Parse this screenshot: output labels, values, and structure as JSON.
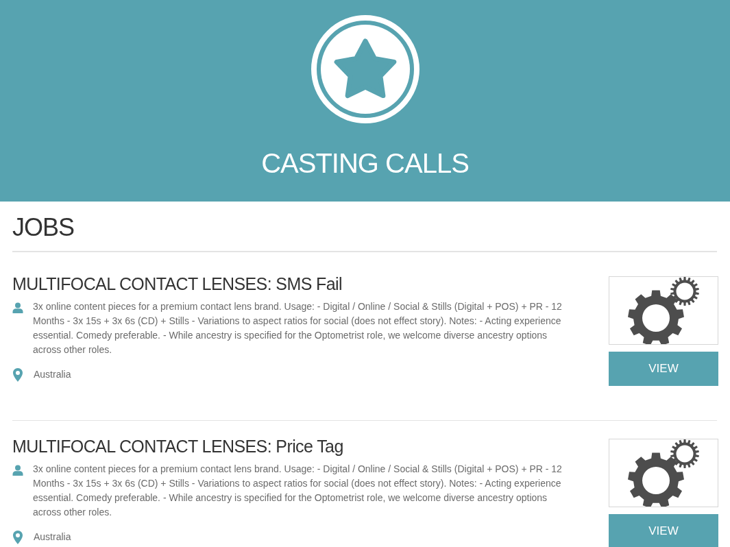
{
  "header": {
    "title": "CASTING CALLS"
  },
  "jobs_section": {
    "heading": "JOBS",
    "jobs": [
      {
        "title": "MULTIFOCAL CONTACT LENSES: SMS Fail",
        "description": "3x online content pieces for a premium contact lens brand. Usage: - Digital / Online / Social & Stills (Digital + POS) + PR - 12 Months - 3x 15s + 3x 6s (CD) + Stills - Variations to aspect ratios for social (does not effect story). Notes: - Acting experience essential. Comedy preferable. - While ancestry is specified for the Optometrist role, we welcome diverse ancestry options across other roles.",
        "location": "Australia",
        "button": "VIEW"
      },
      {
        "title": "MULTIFOCAL CONTACT LENSES: Price Tag",
        "description": "3x online content pieces for a premium contact lens brand. Usage: - Digital / Online / Social & Stills (Digital + POS) + PR - 12 Months - 3x 15s + 3x 6s (CD) + Stills - Variations to aspect ratios for social (does not effect story). Notes: - Acting experience essential. Comedy preferable. - While ancestry is specified for the Optometrist role, we welcome diverse ancestry options across other roles.",
        "location": "Australia",
        "button": "VIEW"
      }
    ]
  }
}
